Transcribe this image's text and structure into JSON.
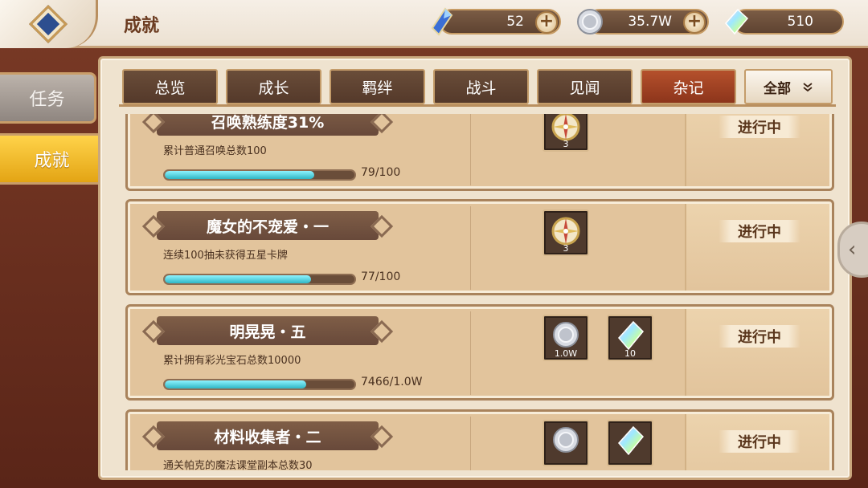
{
  "header": {
    "title": "成就",
    "currencies": [
      {
        "icon": "crystal-icon",
        "value": "52"
      },
      {
        "icon": "coin-icon",
        "value": "35.7W"
      },
      {
        "icon": "rainbow-gem-icon",
        "value": "510"
      }
    ]
  },
  "sidebar": {
    "items": [
      {
        "label": "任务",
        "active": false
      },
      {
        "label": "成就",
        "active": true
      }
    ]
  },
  "tabs": {
    "items": [
      {
        "label": "总览"
      },
      {
        "label": "成长"
      },
      {
        "label": "羁绊"
      },
      {
        "label": "战斗"
      },
      {
        "label": "见闻"
      },
      {
        "label": "杂记",
        "active": true
      }
    ],
    "filter_label": "全部"
  },
  "achievements": [
    {
      "title": "召唤熟练度31%",
      "desc": "累计普通召唤总数100",
      "progress_text": "79/100",
      "progress": 0.79,
      "rewards": [
        {
          "icon": "compass-medal-icon",
          "count": "3"
        }
      ],
      "status": "进行中"
    },
    {
      "title": "魔女的不宠爱・一",
      "desc": "连续100抽未获得五星卡牌",
      "progress_text": "77/100",
      "progress": 0.77,
      "rewards": [
        {
          "icon": "compass-medal-icon",
          "count": "3"
        }
      ],
      "status": "进行中"
    },
    {
      "title": "明晃晃・五",
      "desc": "累计拥有彩光宝石总数10000",
      "progress_text": "7466/1.0W",
      "progress": 0.7466,
      "rewards": [
        {
          "icon": "coin-icon",
          "count": "1.0W"
        },
        {
          "icon": "rainbow-gem-icon",
          "count": "10"
        }
      ],
      "status": "进行中"
    },
    {
      "title": "材料收集者・二",
      "desc": "通关帕克的魔法课堂副本总数30",
      "rewards": [
        {
          "icon": "coin-icon",
          "count": ""
        },
        {
          "icon": "rainbow-gem-icon",
          "count": ""
        }
      ],
      "status": "进行中"
    }
  ],
  "colors": {
    "accent_tab": "#b5502c",
    "progress_fill": "#2fb6c4",
    "sidebar_active": "#ffd34a"
  }
}
